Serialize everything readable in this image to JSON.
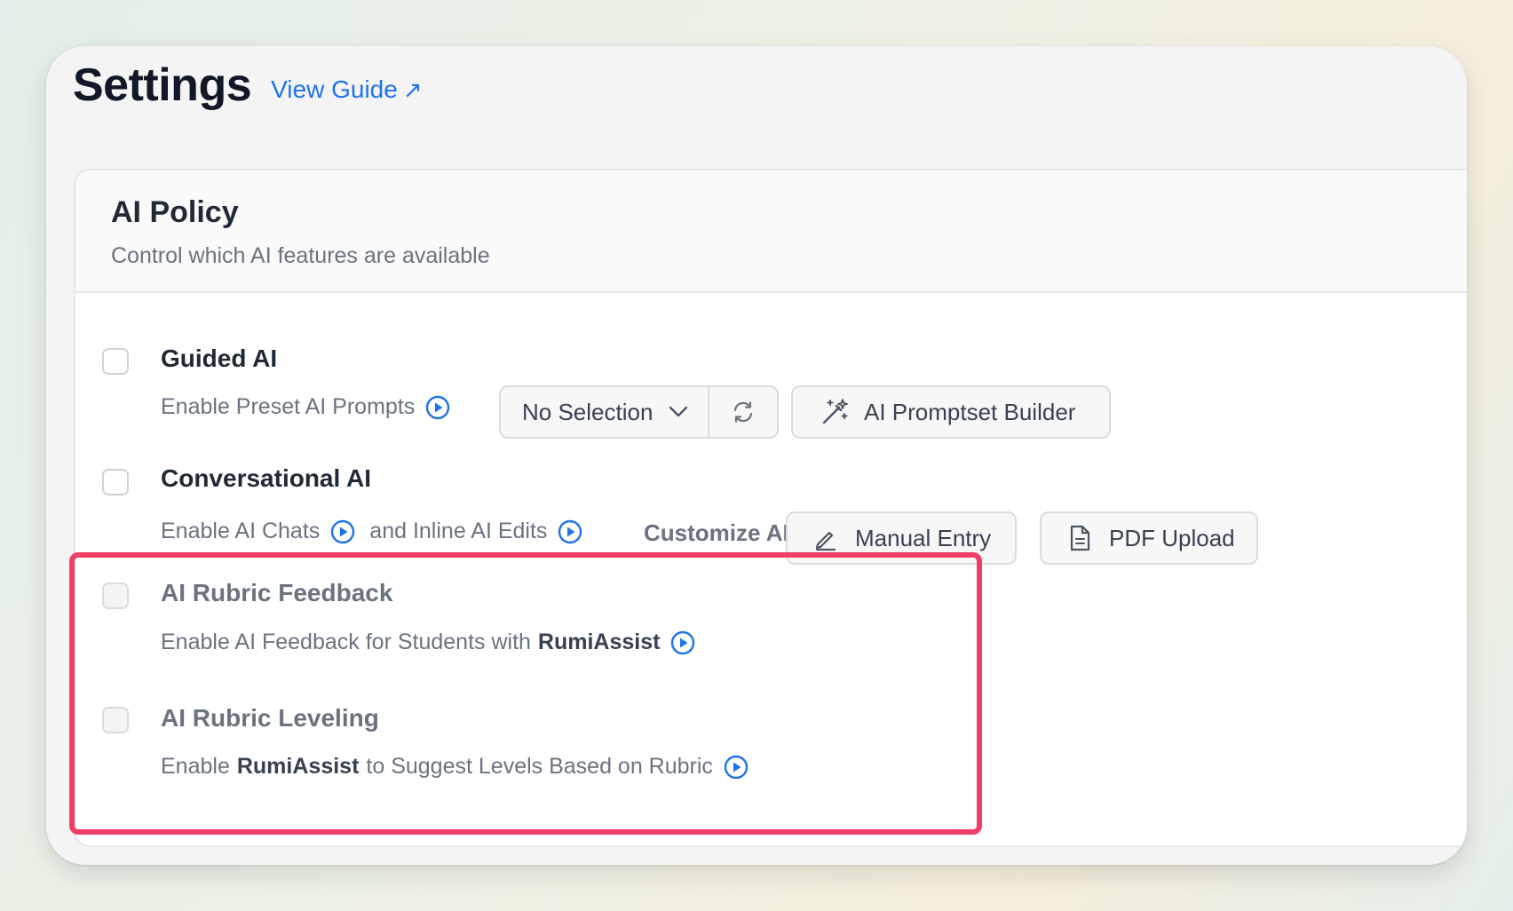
{
  "header": {
    "title": "Settings",
    "guide_link": "View Guide",
    "guide_arrow": "↗"
  },
  "policy": {
    "title": "AI Policy",
    "subtitle": "Control which AI features are available"
  },
  "options": {
    "guided": {
      "title": "Guided AI",
      "desc": "Enable Preset AI Prompts",
      "select_value": "No Selection",
      "builder_label": "AI Promptset Builder"
    },
    "conversational": {
      "title": "Conversational AI",
      "desc_part1": "Enable AI Chats",
      "desc_part2": "and Inline AI Edits",
      "customize_label": "Customize AI",
      "manual_label": "Manual Entry",
      "pdf_label": "PDF Upload"
    },
    "rubric_feedback": {
      "title": "AI Rubric Feedback",
      "desc_prefix": "Enable AI Feedback for Students with",
      "desc_bold": "RumiAssist"
    },
    "rubric_leveling": {
      "title": "AI Rubric Leveling",
      "desc_prefix": "Enable",
      "desc_bold": "RumiAssist",
      "desc_suffix": "to Suggest Levels Based on Rubric"
    }
  },
  "colors": {
    "accent": "#1f73e8",
    "highlight": "#ef3f66"
  },
  "icons": [
    "arrow-up-right-icon",
    "play-circle-icon",
    "chevron-down-icon",
    "refresh-icon",
    "magic-wand-icon",
    "pencil-icon",
    "document-icon"
  ]
}
